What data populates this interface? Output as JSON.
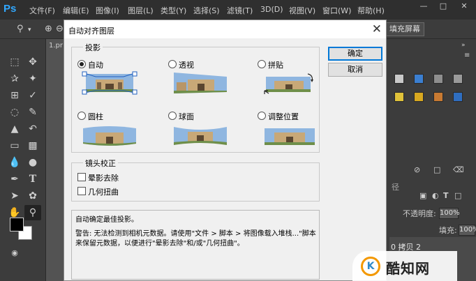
{
  "app": {
    "logo": "Ps",
    "menu": [
      "文件(F)",
      "编辑(E)",
      "图像(I)",
      "图层(L)",
      "类型(Y)",
      "选择(S)",
      "滤镜(T)",
      "3D(D)",
      "视图(V)",
      "窗口(W)",
      "帮助(H)"
    ],
    "window_controls": [
      "minimize-icon",
      "maximize-icon",
      "close-icon"
    ]
  },
  "options_bar": {
    "fill_screen_label": "填充屏幕"
  },
  "document": {
    "tab_label": "1.pr"
  },
  "right_panel": {
    "opacity_label": "不透明度:",
    "opacity_value": "100%",
    "fill_label": "填充:",
    "fill_value": "100%",
    "layer_name": "0 拷贝 2",
    "tab_fragment": "径"
  },
  "dialog": {
    "title": "自动对齐图层",
    "projection_group": "投影",
    "options": [
      {
        "label": "自动",
        "checked": true
      },
      {
        "label": "透视",
        "checked": false
      },
      {
        "label": "拼贴",
        "checked": false
      },
      {
        "label": "圆柱",
        "checked": false
      },
      {
        "label": "球面",
        "checked": false
      },
      {
        "label": "调整位置",
        "checked": false
      }
    ],
    "lens_group": "镜头校正",
    "checkboxes": [
      {
        "label": "晕影去除",
        "checked": false
      },
      {
        "label": "几何扭曲",
        "checked": false
      }
    ],
    "description_title": "自动确定最佳投影。",
    "warning_line1": "警告: 无法检测到相机元数据。请使用\"文件 > 脚本 > 将图像载入堆栈...\"脚本",
    "warning_line2": "来保留元数据，以便进行\"晕影去除\"和/或\"几何扭曲\"。",
    "ok_label": "确定",
    "cancel_label": "取消"
  },
  "watermark": {
    "logo": "K",
    "text": "酷知网"
  }
}
